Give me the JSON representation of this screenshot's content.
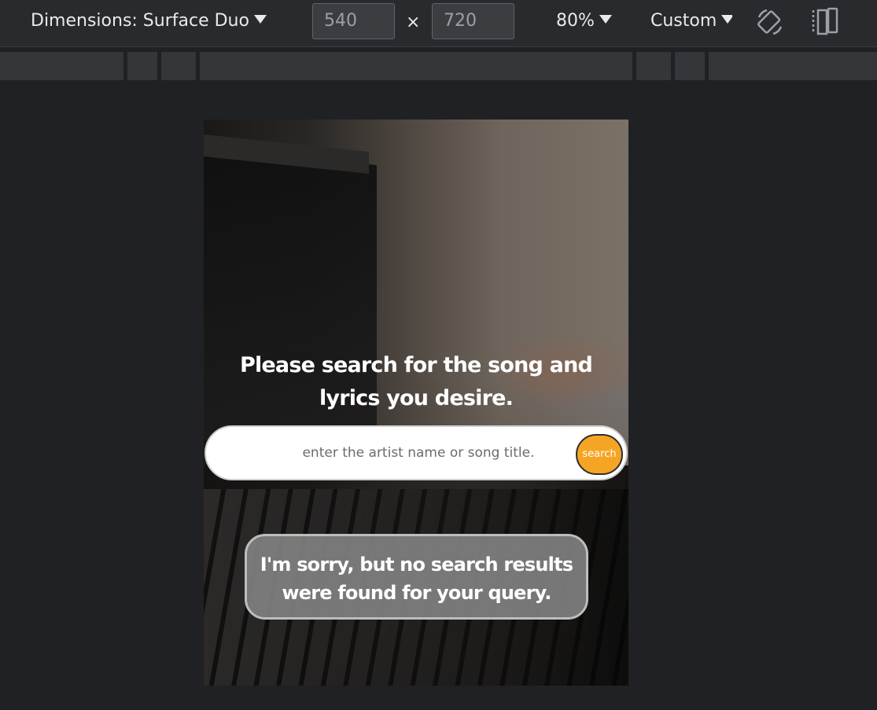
{
  "toolbar": {
    "dimensions_label": "Dimensions: Surface Duo",
    "width_value": "540",
    "height_value": "720",
    "separator": "×",
    "zoom": "80%",
    "throttle": "Custom",
    "rotate_icon": "rotate-icon",
    "dual_screen_icon": "dual-screen-icon"
  },
  "page": {
    "headline": "Please search for the song and lyrics you desire.",
    "search_placeholder": "enter the artist name or song title.",
    "search_button": "search",
    "no_results": "I'm sorry, but no search results were found for your query."
  },
  "colors": {
    "accent": "#f5a524",
    "toolbar_bg": "#292a2d",
    "canvas_bg": "#202124"
  }
}
